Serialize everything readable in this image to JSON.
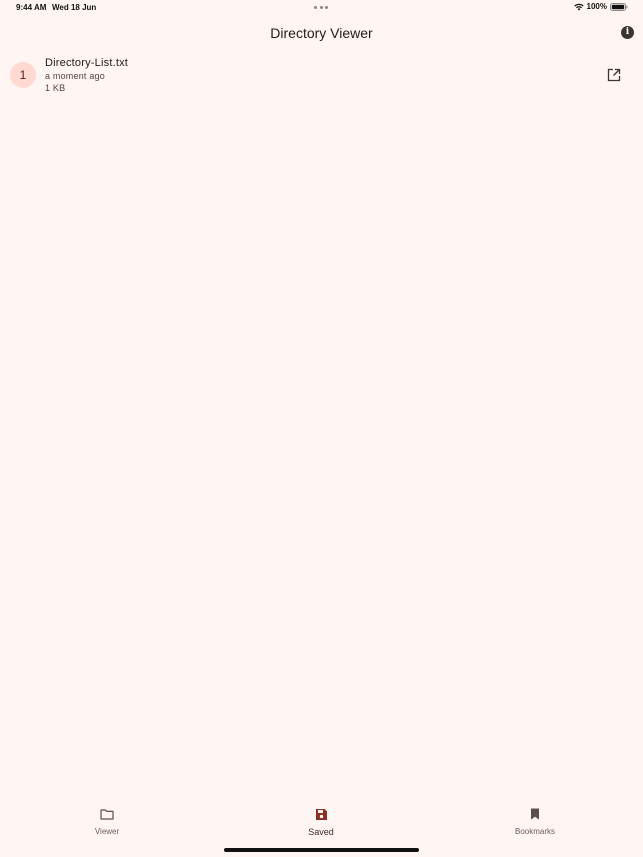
{
  "status_bar": {
    "time": "9:44 AM",
    "date": "Wed 18 Jun",
    "battery_percent": "100%",
    "wifi_icon": "wifi-icon",
    "battery_icon": "battery-full-icon"
  },
  "app_bar": {
    "title": "Directory Viewer",
    "info_glyph": "i",
    "info_icon": "info-icon"
  },
  "files": [
    {
      "index": "1",
      "name": "Directory-List.txt",
      "modified": "a moment ago",
      "size": "1 KB",
      "action_icon": "open-in-new-icon"
    }
  ],
  "bottom_nav": {
    "items": [
      {
        "label": "Viewer",
        "icon": "folder-icon",
        "active": false
      },
      {
        "label": "Saved",
        "icon": "save-icon",
        "active": true
      },
      {
        "label": "Bookmarks",
        "icon": "bookmark-icon",
        "active": false
      }
    ]
  },
  "colors": {
    "background": "#fff6f4",
    "avatar_bg": "#ffd9d2",
    "active_icon": "#8b2f24"
  }
}
